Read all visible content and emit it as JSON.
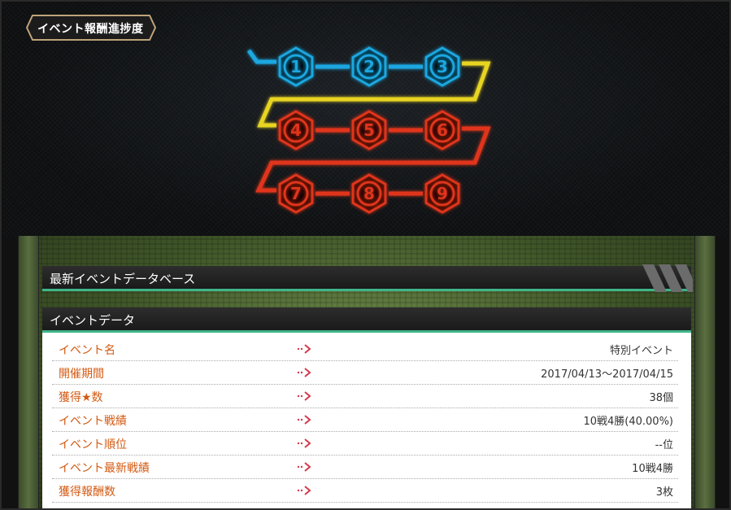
{
  "progress_panel": {
    "title": "イベント報酬進捗度",
    "steps": [
      {
        "number": "1",
        "color": "#1aa7e0"
      },
      {
        "number": "2",
        "color": "#1aa7e0"
      },
      {
        "number": "3",
        "color": "#1aa7e0"
      },
      {
        "number": "4",
        "color": "#e0341c"
      },
      {
        "number": "5",
        "color": "#e0341c"
      },
      {
        "number": "6",
        "color": "#e0341c"
      },
      {
        "number": "7",
        "color": "#e0341c"
      },
      {
        "number": "8",
        "color": "#e0341c"
      },
      {
        "number": "9",
        "color": "#e0341c"
      }
    ],
    "track_colors": {
      "row1": "#1aa7e0",
      "turn1": "#e8d424",
      "row2": "#e0341c",
      "turn2": "#e0341c",
      "row3": "#e0341c"
    },
    "completed_steps": 3
  },
  "database": {
    "header": "最新イベントデータベース",
    "section_title": "イベントデータ",
    "rows": [
      {
        "label": "イベント名",
        "value": "特別イベント"
      },
      {
        "label": "開催期間",
        "value": "2017/04/13～2017/04/15"
      },
      {
        "label": "獲得★数",
        "value": "38個"
      },
      {
        "label": "イベント戦績",
        "value": "10戦4勝(40.00%)"
      },
      {
        "label": "イベント順位",
        "value": "--位"
      },
      {
        "label": "イベント最新戦績",
        "value": "10戦4勝"
      },
      {
        "label": "獲得報酬数",
        "value": "3枚"
      }
    ]
  },
  "colors": {
    "accent_green": "#3fb58a",
    "label_orange": "#d35a12",
    "arrow_red": "#d33a4a"
  }
}
